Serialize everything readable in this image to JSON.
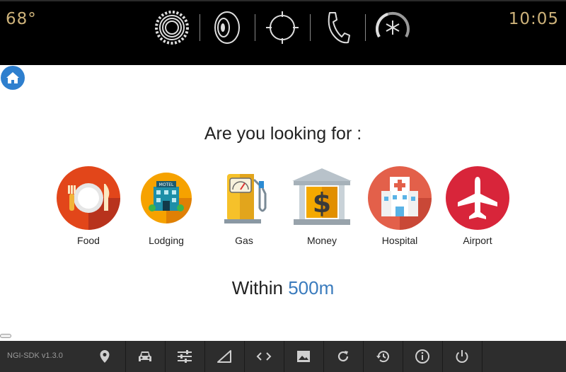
{
  "status_bar": {
    "temperature": "68°",
    "time": "10:05",
    "icons": [
      "settings-gear-icon",
      "speaker-icon",
      "navigation-crosshair-icon",
      "phone-icon",
      "climate-fan-icon"
    ]
  },
  "home_icon": "home-icon",
  "prompt": {
    "question": "Are you looking for :",
    "within_label": "Within",
    "distance": "500m"
  },
  "categories": [
    {
      "label": "Food",
      "icon": "food-plate-icon",
      "color": "#e2461a"
    },
    {
      "label": "Lodging",
      "icon": "motel-icon",
      "color": "#f6a200"
    },
    {
      "label": "Gas",
      "icon": "gas-pump-icon",
      "color": "#f6c12a"
    },
    {
      "label": "Money",
      "icon": "bank-dollar-icon",
      "color": "#f4a900"
    },
    {
      "label": "Hospital",
      "icon": "hospital-icon",
      "color": "#e3604a"
    },
    {
      "label": "Airport",
      "icon": "airplane-icon",
      "color": "#d8253a"
    }
  ],
  "footer": {
    "sdk_version": "NGI-SDK v1.3.0",
    "buttons": [
      "location-pin-icon",
      "car-icon",
      "sliders-icon",
      "signal-icon",
      "code-icon",
      "image-icon",
      "refresh-icon",
      "history-icon",
      "info-icon",
      "power-icon"
    ]
  }
}
